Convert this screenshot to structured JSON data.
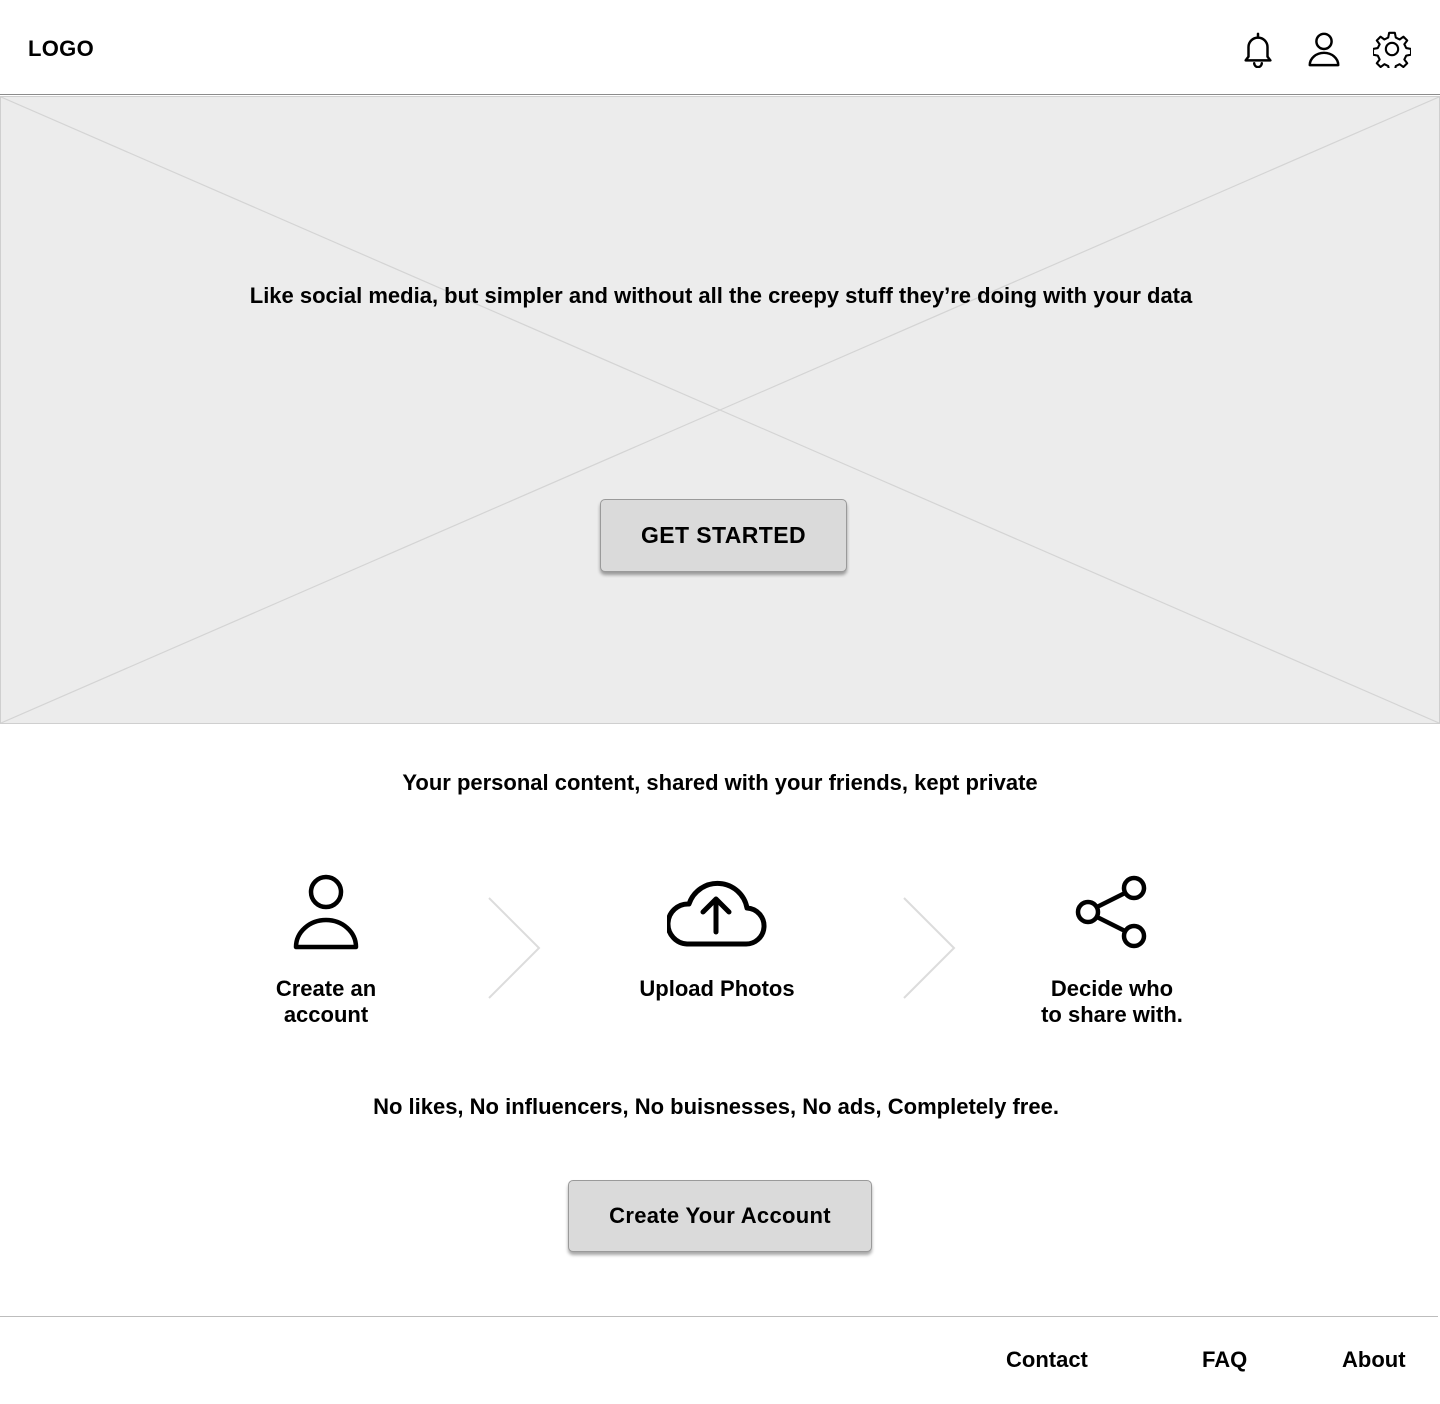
{
  "header": {
    "logo": "LOGO",
    "icons": [
      "bell-icon",
      "user-icon",
      "gear-icon"
    ]
  },
  "hero": {
    "tagline": "Like social media, but simpler and without all the creepy stuff they’re doing with your data",
    "cta_label": "GET STARTED",
    "placeholder": "image-placeholder-x"
  },
  "main": {
    "subtitle": "Your personal content, shared with your friends, kept private",
    "steps": [
      {
        "icon": "user-icon",
        "label": "Create an\naccount"
      },
      {
        "icon": "cloud-upload-icon",
        "label": "Upload Photos"
      },
      {
        "icon": "share-icon",
        "label": "Decide who\nto share with."
      }
    ],
    "benefits": "No likes, No influencers, No buisnesses, No ads, Completely free.",
    "cta_label": "Create Your Account"
  },
  "footer": {
    "links": [
      "Contact",
      "FAQ",
      "About"
    ]
  },
  "colors": {
    "hero_background": "#ececec",
    "button_background": "#dadada",
    "text": "#000000"
  }
}
